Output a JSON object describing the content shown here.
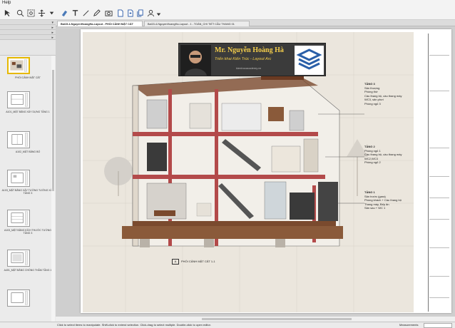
{
  "menu": {
    "help": "Help"
  },
  "toolbar": {
    "icons": [
      "select-icon",
      "zoom-icon",
      "zoom-window-icon",
      "pan-icon",
      "paint-icon",
      "text-icon",
      "line-icon",
      "pencil-icon",
      "erase-icon",
      "camera-icon",
      "page-icon",
      "page-add-icon",
      "page-copy-icon",
      "user-icon"
    ]
  },
  "tabs": [
    {
      "label": "Bai15-4-NguyenHoangHa-Layout - PHỐI CẢNH MẶT CẮT"
    },
    {
      "label": "Bai15-4-NguyenHoangHa-Layout - 1 - TOÀN_CHI TIẾT CẦU THANG 01"
    }
  ],
  "sidebar": {
    "thumbs": [
      {
        "label": "PHỐI CẢNH MẶT CẮT"
      },
      {
        "label": "A101_MẶT BẰNG XÂY DỰNG TẦNG 1"
      },
      {
        "label": "A102_MẶT BẰNG BỐ"
      },
      {
        "label": "A103_MẶT BẰNG XÂY TƯỜNG TƯỜNG XÂY TẦNG 3"
      },
      {
        "label": "A103_MẶT BẰNG KÍCH THƯỚC TƯỜNG TẦNG 3"
      },
      {
        "label": "A401_MẶT BẰNG CHỐNG THẤM TẦNG 1"
      }
    ]
  },
  "banner": {
    "name": "Mr. Nguyễn Hoàng Hà",
    "subtitle": "Triển khai Kiến Trúc - Layout Arc",
    "website": "kientrucacademy.vn"
  },
  "notes": {
    "t3": {
      "head": "TẦNG 3",
      "lines": [
        "Sân thượng",
        "Phòng thờ",
        "Cầu thang bộ, cầu thang máy",
        "WC3, sân phơi",
        "Phòng ngủ 3"
      ]
    },
    "t2": {
      "head": "TẦNG 2",
      "lines": [
        "Phòng ngủ 1",
        "Cầu thang bộ, cầu thang máy",
        "WC2,WC3",
        "Phòng ngủ 2"
      ]
    },
    "t1": {
      "head": "TẦNG 1",
      "lines": [
        "Sân trước (gara)",
        "Phòng khách + Cầu thang bộ",
        "Thang máy, Bếp ăn",
        "Sân sau + WC 1"
      ]
    }
  },
  "caption": {
    "tag": "A",
    "text": "PHỐI CẢNH MẶT CẮT 1-1"
  },
  "status": {
    "message": "Click to select items to manipulate. Shift-click to extend selection. Click-drag to select multiple. Double-click to open editor.",
    "measurements_label": "Measurements"
  },
  "colors": {
    "accent": "#f3cd4b",
    "section_red": "#b34a4a",
    "wood": "#7a4a2e"
  }
}
